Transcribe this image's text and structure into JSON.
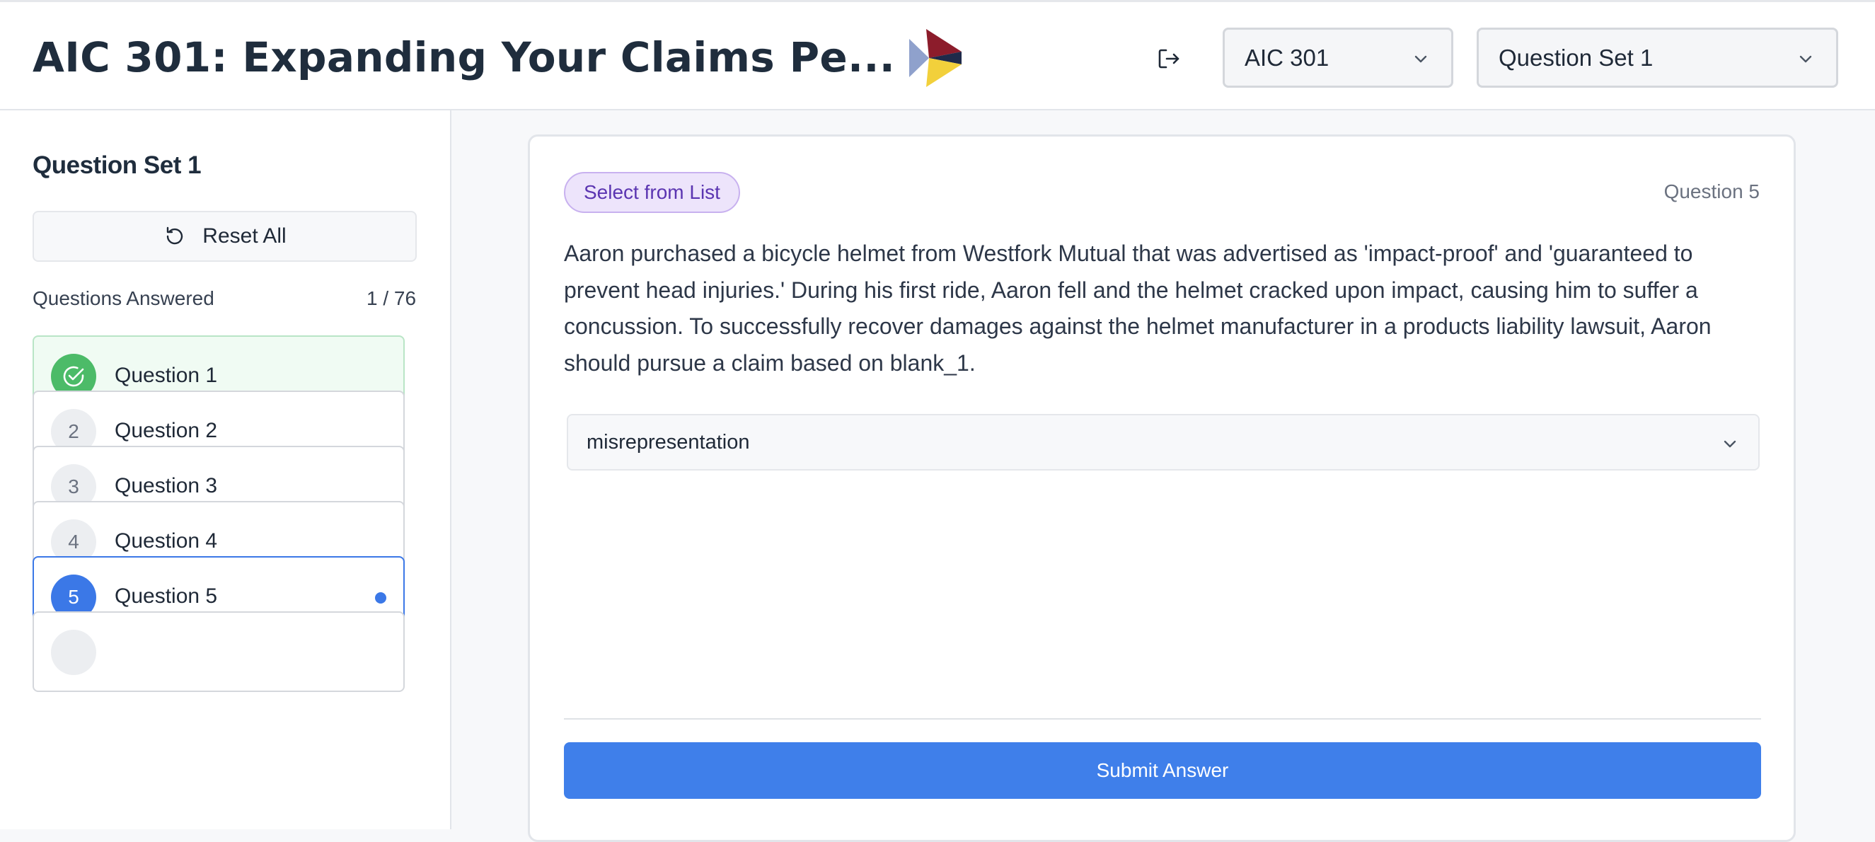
{
  "header": {
    "title": "AIC 301: Expanding Your Claims Pe...",
    "course_select": {
      "value": "AIC 301"
    },
    "set_select": {
      "value": "Question Set 1"
    }
  },
  "sidebar": {
    "title": "Question Set 1",
    "reset_label": "Reset All",
    "answered_label": "Questions Answered",
    "answered_count": "1 / 76",
    "items": [
      {
        "number": "1",
        "label": "Question 1",
        "status": "answered"
      },
      {
        "number": "2",
        "label": "Question 2",
        "status": "unanswered"
      },
      {
        "number": "3",
        "label": "Question 3",
        "status": "unanswered"
      },
      {
        "number": "4",
        "label": "Question 4",
        "status": "unanswered"
      },
      {
        "number": "5",
        "label": "Question 5",
        "status": "current"
      }
    ]
  },
  "question": {
    "type_badge": "Select from List",
    "number_label": "Question 5",
    "text": "Aaron purchased a bicycle helmet from Westfork Mutual that was advertised as 'impact-proof' and 'guaranteed to prevent head injuries.' During his first ride, Aaron fell and the helmet cracked upon impact, causing him to suffer a concussion. To successfully recover damages against the helmet manufacturer in a products liability lawsuit, Aaron should pursue a claim based on blank_1.",
    "selected_answer": "misrepresentation",
    "submit_label": "Submit Answer"
  },
  "colors": {
    "accent": "#3f7fea",
    "success": "#4cbb68",
    "badge_bg": "#ede4fb",
    "badge_text": "#5b35b1"
  },
  "icons": {
    "logo": "play-triangle-logo",
    "logout": "logout-icon",
    "reset": "reset-icon",
    "dropdown": "chevron-down-icon",
    "answered": "check-circle-icon"
  }
}
